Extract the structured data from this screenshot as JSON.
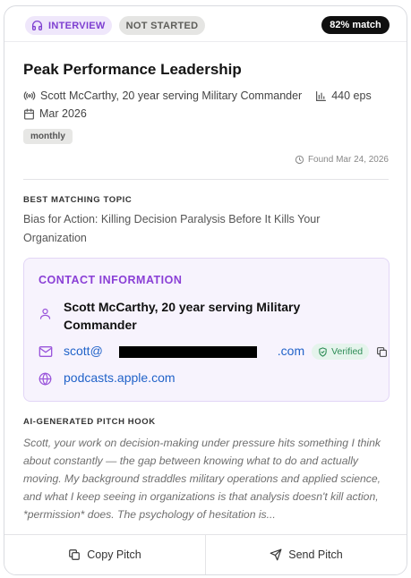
{
  "badges": {
    "type_label": "INTERVIEW",
    "status_label": "NOT STARTED",
    "match_label": "82% match"
  },
  "podcast": {
    "title": "Peak Performance Leadership",
    "host": "Scott McCarthy, 20 year serving Military Commander",
    "episodes": "440 eps",
    "date": "Mar 2026",
    "frequency": "monthly",
    "found": "Found Mar 24, 2026"
  },
  "topic": {
    "label": "BEST MATCHING TOPIC",
    "text": "Bias for Action: Killing Decision Paralysis Before It Kills Your Organization"
  },
  "contact": {
    "title": "CONTACT INFORMATION",
    "name": "Scott McCarthy, 20 year serving Military Commander",
    "email_visible_start": "scott@",
    "email_visible_end": ".com",
    "verified_label": "Verified",
    "website": "podcasts.apple.com"
  },
  "pitch": {
    "label": "AI-GENERATED PITCH HOOK",
    "text": "Scott, your work on decision-making under pressure hits something I think about constantly — the gap between knowing what to do and actually moving. My background straddles military operations and applied science, and what I keep seeing in organizations is that analysis doesn't kill action, *permission* does. The psychology of hesitation is..."
  },
  "footer": {
    "copy_label": "Copy Pitch",
    "send_label": "Send Pitch"
  },
  "colors": {
    "accent_purple": "#8a3fd6",
    "link_blue": "#2163c9",
    "verified_green": "#2d8c56",
    "match_bg": "#0f0f0f"
  }
}
